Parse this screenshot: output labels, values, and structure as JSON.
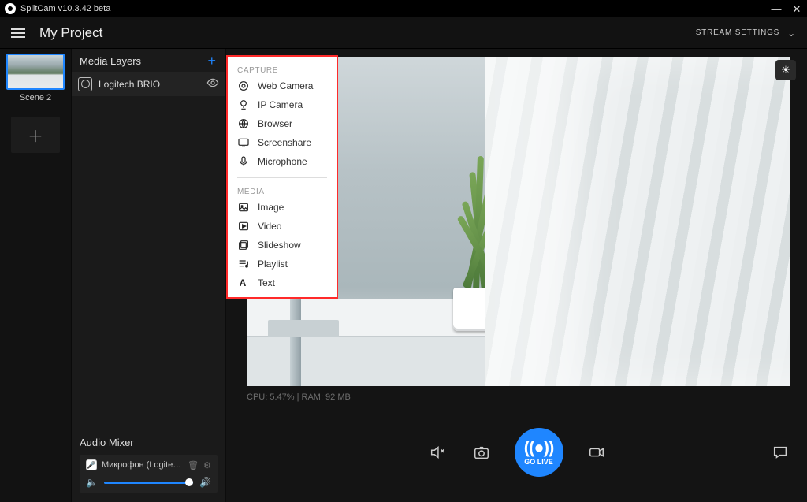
{
  "app": {
    "title": "SplitCam v10.3.42 beta"
  },
  "header": {
    "project_title": "My Project",
    "stream_settings_label": "STREAM SETTINGS"
  },
  "scenes": {
    "items": [
      {
        "label": "Scene 2"
      }
    ]
  },
  "layers": {
    "title": "Media Layers",
    "items": [
      {
        "label": "Logitech BRIO"
      }
    ]
  },
  "add_menu": {
    "capture_head": "CAPTURE",
    "media_head": "MEDIA",
    "capture": [
      {
        "label": "Web Camera"
      },
      {
        "label": "IP Camera"
      },
      {
        "label": "Browser"
      },
      {
        "label": "Screenshare"
      },
      {
        "label": "Microphone"
      }
    ],
    "media": [
      {
        "label": "Image"
      },
      {
        "label": "Video"
      },
      {
        "label": "Slideshow"
      },
      {
        "label": "Playlist"
      },
      {
        "label": "Text"
      }
    ]
  },
  "mixer": {
    "title": "Audio Mixer",
    "items": [
      {
        "label": "Микрофон  (Logitech..."
      }
    ]
  },
  "stats": {
    "text": "CPU: 5.47% | RAM: 92 MB"
  },
  "bottom": {
    "golive_label": "GO LIVE"
  }
}
